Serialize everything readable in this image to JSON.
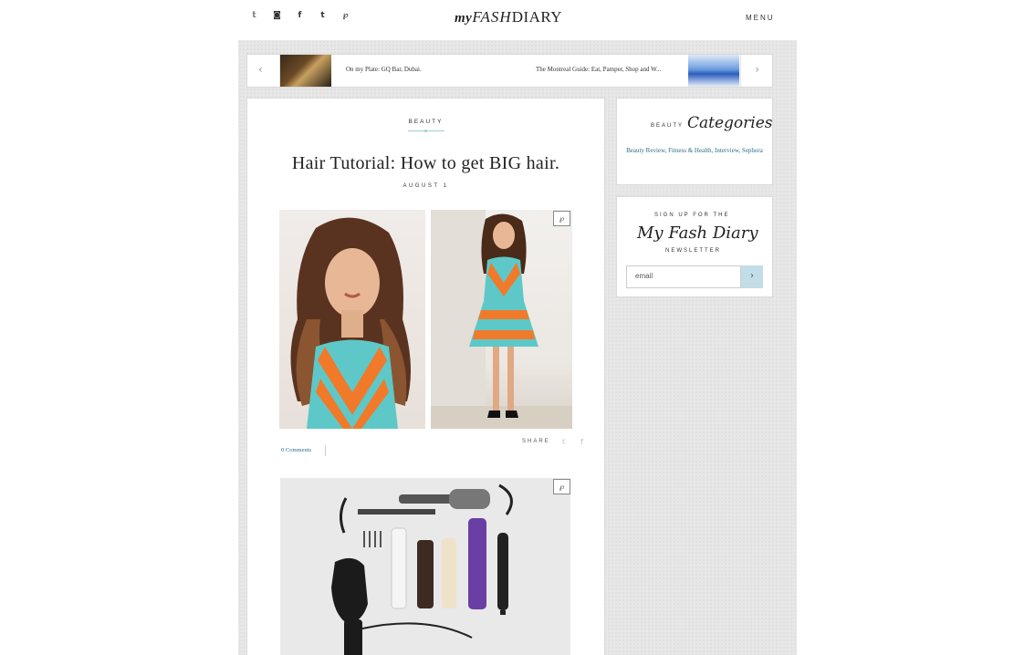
{
  "header": {
    "social_icons": [
      {
        "name": "twitter-icon",
        "glyph": "𝕥"
      },
      {
        "name": "instagram-icon",
        "glyph": "◙"
      },
      {
        "name": "facebook-icon",
        "glyph": "f"
      },
      {
        "name": "tumblr-icon",
        "glyph": "t"
      },
      {
        "name": "pinterest-icon",
        "glyph": "℘"
      }
    ],
    "logo_my": "my",
    "logo_fash": "FASH",
    "logo_diary": "DIARY",
    "menu_label": "MENU"
  },
  "slider": {
    "prev_icon": "chevron-left-icon",
    "next_icon": "chevron-right-icon",
    "left_title": "On my Plate: GQ Bar, Dubai.",
    "right_title": "The Montreal Guide: Eat, Pamper, Shop and W..."
  },
  "post": {
    "category": "BEAUTY",
    "title": "Hair Tutorial: How to get BIG hair.",
    "date": "AUGUST 1",
    "pin_glyph": "℘",
    "comments": "0 Comments",
    "share_label": "SHARE",
    "share_icons": [
      "twitter-icon",
      "facebook-icon"
    ]
  },
  "sidebar": {
    "categories_widget": {
      "label": "BEAUTY",
      "script": "Categories",
      "links": "Beauty Review, Fitness & Health, Interview, Sephora"
    },
    "newsletter_widget": {
      "top_label": "SIGN UP FOR THE",
      "script": "My Fash Diary",
      "bottom_label": "NEWSLETTER",
      "email_placeholder": "email",
      "submit_glyph": "›"
    }
  },
  "colors": {
    "accent_link": "#2a6d8a",
    "accent_teal": "#9ccfd4",
    "submit_bg": "#c2dde6",
    "column_bg": "#e7e7e7"
  }
}
